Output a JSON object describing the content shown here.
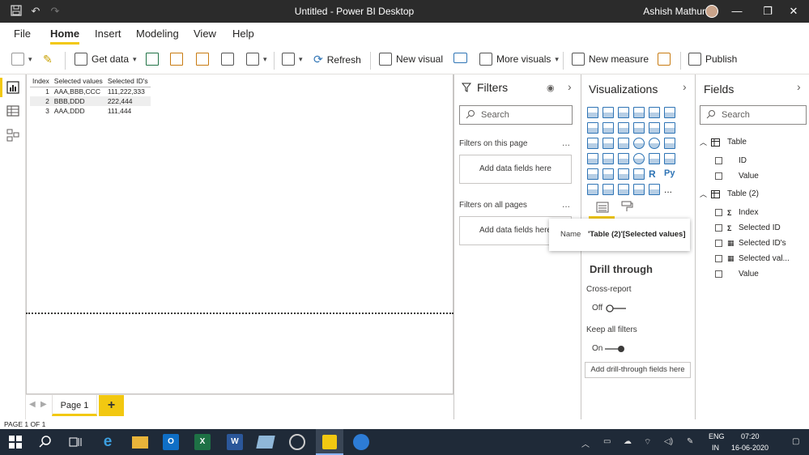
{
  "titlebar": {
    "app_title": "Untitled - Power BI Desktop",
    "user_name": "Ashish Mathur"
  },
  "menubar": {
    "items": [
      "File",
      "Home",
      "Insert",
      "Modeling",
      "View",
      "Help"
    ],
    "active": "Home"
  },
  "ribbon": {
    "get_data": "Get data",
    "refresh": "Refresh",
    "new_visual": "New visual",
    "more_visuals": "More visuals",
    "new_measure": "New measure",
    "publish": "Publish"
  },
  "table": {
    "headers": [
      "Index",
      "Selected values",
      "Selected ID's"
    ],
    "rows": [
      {
        "index": "1",
        "values": "AAA,BBB,CCC",
        "ids": "111,222,333"
      },
      {
        "index": "2",
        "values": "BBB,DDD",
        "ids": "222,444"
      },
      {
        "index": "3",
        "values": "AAA,DDD",
        "ids": "111,444"
      }
    ]
  },
  "pages": {
    "tab": "Page 1",
    "add": "+"
  },
  "filters": {
    "title": "Filters",
    "search_placeholder": "Search",
    "on_this_page": "Filters on this page",
    "on_all_pages": "Filters on all pages",
    "add_fields": "Add data fields here",
    "more": "..."
  },
  "visualizations": {
    "title": "Visualizations",
    "r_label": "R",
    "py_label": "Py",
    "more": "...",
    "drill_through": "Drill through",
    "cross_report": "Cross-report",
    "cross_report_state": "Off",
    "keep_all_filters": "Keep all filters",
    "keep_all_filters_state": "On",
    "add_drill": "Add drill-through fields here"
  },
  "tooltip": {
    "label": "Name",
    "value": "'Table (2)'[Selected values]"
  },
  "fields": {
    "title": "Fields",
    "search_placeholder": "Search",
    "tables": [
      {
        "name": "Table",
        "items": [
          {
            "name": "ID",
            "kind": ""
          },
          {
            "name": "Value",
            "kind": ""
          }
        ]
      },
      {
        "name": "Table (2)",
        "items": [
          {
            "name": "Index",
            "kind": "sigma"
          },
          {
            "name": "Selected ID",
            "kind": "sigma"
          },
          {
            "name": "Selected ID's",
            "kind": "calc"
          },
          {
            "name": "Selected val...",
            "kind": "calc"
          },
          {
            "name": "Value",
            "kind": ""
          }
        ]
      }
    ]
  },
  "status": {
    "page_info": "PAGE 1 OF 1"
  },
  "taskbar": {
    "lang": "ENG",
    "region": "IN",
    "time": "07:20",
    "date": "16-06-2020"
  },
  "colors": {
    "accent": "#f2c811",
    "taskbar": "#1f2a38",
    "titlebar": "#2b2b2b"
  }
}
